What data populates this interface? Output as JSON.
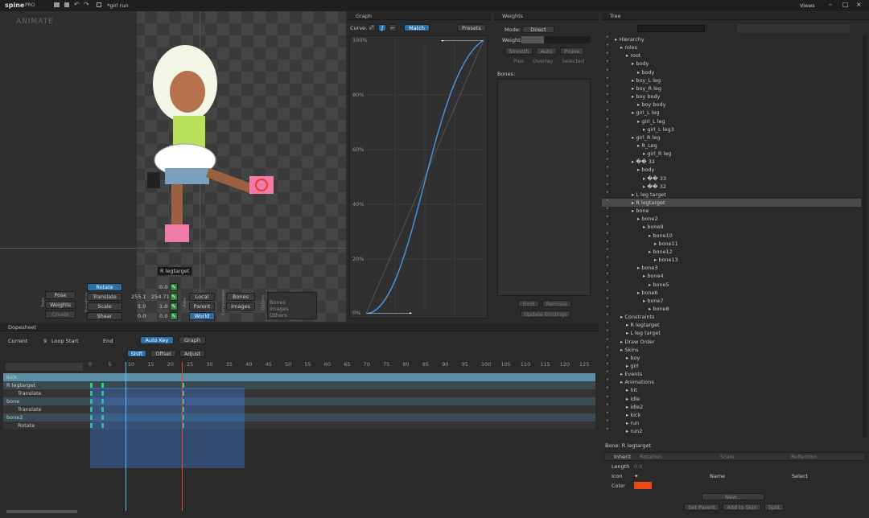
{
  "app": {
    "logo": "spine",
    "edition": "PRO",
    "file": "*girl run",
    "views": "Views",
    "mode": "ANIMATE"
  },
  "colors": {
    "accent": "#2a6fa8",
    "key": "#2ecf7a",
    "playhead": "#4fc3f7",
    "red": "#e64a19"
  },
  "tools": {
    "side_label": "Tools",
    "pose": "Pose",
    "weights": "Weights",
    "create": "Create",
    "transform_label": "Transform",
    "rotate": "Rotate",
    "rotate_val": "0.0",
    "translate": "Translate",
    "translate_x": "255.1",
    "translate_y": "254.71",
    "scale": "Scale",
    "scale_x": "1.0",
    "scale_y": "1.0",
    "shear": "Shear",
    "shear_x": "0.0",
    "shear_y": "0.0",
    "axes_label": "Axes",
    "local": "Local",
    "parent": "Parent",
    "world": "World",
    "compensate_label": "Compensate",
    "bones_btn": "Bones",
    "images_btn": "Images",
    "options_label": "Options",
    "opt_bones": "Bones",
    "opt_images": "Images",
    "opt_others": "Others",
    "tooltip": "R legtarget"
  },
  "graph": {
    "title": "Graph",
    "curve": "Curve:",
    "match": "Match",
    "presets": "Presets",
    "y_ticks": [
      "100%",
      "80%",
      "60%",
      "40%",
      "20%",
      "0%"
    ]
  },
  "weights": {
    "title": "Weights",
    "mode_label": "Mode:",
    "mode": "Direct",
    "weight_label": "Weight:",
    "smooth": "Smooth",
    "auto": "Auto",
    "prune": "Prune",
    "pies": "Pies",
    "overlay": "Overlay",
    "selected": "Selected",
    "bones_label": "Bones:",
    "bind": "Bind",
    "remove": "Remove",
    "update": "Update Bindings"
  },
  "tree": {
    "title": "Tree",
    "items": [
      {
        "t": "Hierarchy",
        "d": 0
      },
      {
        "t": "roles",
        "d": 1
      },
      {
        "t": "root",
        "d": 2
      },
      {
        "t": "body",
        "d": 3
      },
      {
        "t": "body",
        "d": 4
      },
      {
        "t": "boy_L leg",
        "d": 3
      },
      {
        "t": "boy_R leg",
        "d": 3
      },
      {
        "t": "boy body",
        "d": 3
      },
      {
        "t": "boy body",
        "d": 4
      },
      {
        "t": "girl_L leg",
        "d": 3
      },
      {
        "t": "girl_L leg",
        "d": 4
      },
      {
        "t": "girl_L leg3",
        "d": 5
      },
      {
        "t": "girl_R leg",
        "d": 3
      },
      {
        "t": "R_Leg",
        "d": 4
      },
      {
        "t": "girl_R leg",
        "d": 5
      },
      {
        "t": "�� 32",
        "d": 3
      },
      {
        "t": "body",
        "d": 4
      },
      {
        "t": "�� 33",
        "d": 5
      },
      {
        "t": "�� 32",
        "d": 5
      },
      {
        "t": "L leg target",
        "d": 3
      },
      {
        "t": "R legtarget",
        "d": 3,
        "sel": true
      },
      {
        "t": "bone",
        "d": 3
      },
      {
        "t": "bone2",
        "d": 4
      },
      {
        "t": "bone9",
        "d": 5
      },
      {
        "t": "bone10",
        "d": 6
      },
      {
        "t": "bone11",
        "d": 7
      },
      {
        "t": "bone12",
        "d": 6
      },
      {
        "t": "bone13",
        "d": 7
      },
      {
        "t": "bone3",
        "d": 4
      },
      {
        "t": "bone4",
        "d": 5
      },
      {
        "t": "bone5",
        "d": 6
      },
      {
        "t": "bone6",
        "d": 4
      },
      {
        "t": "bone7",
        "d": 5
      },
      {
        "t": "bone8",
        "d": 6
      },
      {
        "t": "Constraints",
        "d": 1
      },
      {
        "t": "R legtarget",
        "d": 2
      },
      {
        "t": "L leg target",
        "d": 2
      },
      {
        "t": "Draw Order",
        "d": 1
      },
      {
        "t": "Skins",
        "d": 1
      },
      {
        "t": "boy",
        "d": 2
      },
      {
        "t": "girl",
        "d": 2
      },
      {
        "t": "Events",
        "d": 1
      },
      {
        "t": "Animations",
        "d": 1
      },
      {
        "t": "hit",
        "d": 2
      },
      {
        "t": "idle",
        "d": 2
      },
      {
        "t": "idle2",
        "d": 2
      },
      {
        "t": "kick",
        "d": 2
      },
      {
        "t": "run",
        "d": 2
      },
      {
        "t": "run2",
        "d": 2
      }
    ]
  },
  "props": {
    "title": "Bone: R legtarget",
    "inherit": "Inherit",
    "rotation": "Rotation",
    "scale": "Scale",
    "reflection": "Reflection",
    "length": "Length",
    "length_val": "0.0",
    "icon": "Icon",
    "name": "Name",
    "select": "Select",
    "color": "Color",
    "new": "New...",
    "set_parent": "Set Parent",
    "add_skin": "Add to Skin",
    "split": "Split"
  },
  "dopesheet": {
    "title": "Dopesheet",
    "current": "Current",
    "current_val": "9",
    "loop_start": "Loop Start",
    "end": "End",
    "auto_key": "Auto Key",
    "graph": "Graph",
    "shift": "Shift",
    "offset": "Offset",
    "adjust": "Adjust",
    "ruler": [
      "0",
      "5",
      "10",
      "15",
      "20",
      "25",
      "30",
      "35",
      "40",
      "45",
      "50",
      "55",
      "60",
      "65",
      "70",
      "75",
      "80",
      "85",
      "90",
      "95",
      "100",
      "105",
      "110",
      "115",
      "120",
      "125"
    ],
    "rows": [
      "kick",
      "R legtarget",
      "Translate",
      "bone",
      "Translate",
      "bone2",
      "Rotate"
    ]
  }
}
